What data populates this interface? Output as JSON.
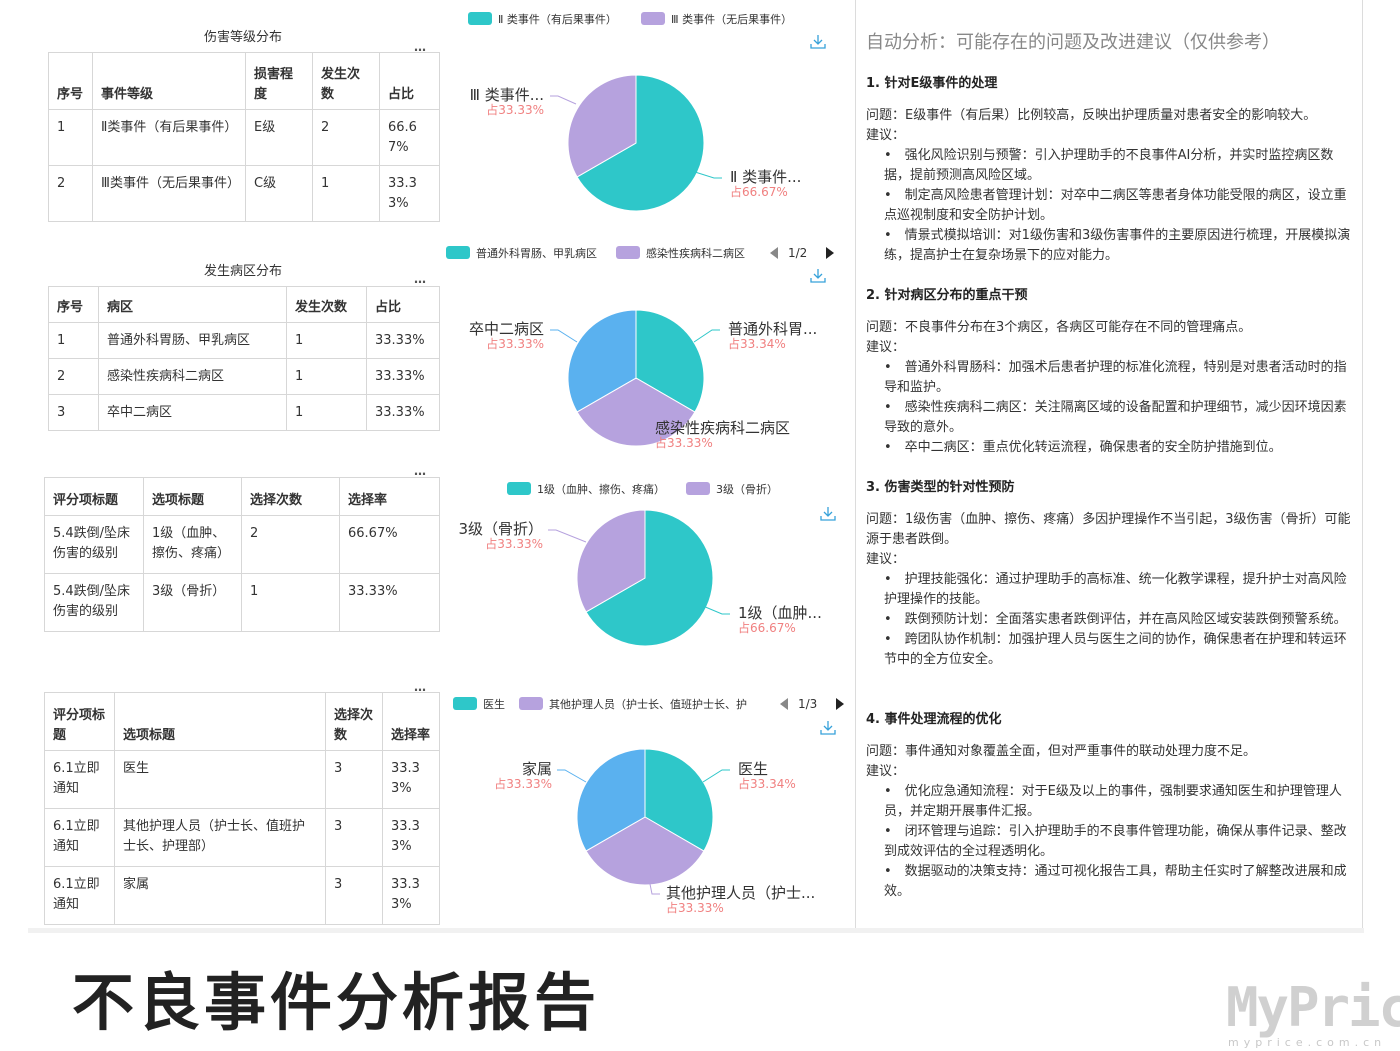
{
  "tables": [
    {
      "title": "伤害等级分布",
      "headers": [
        "序号",
        "事件等级",
        "损害程度",
        "发生次数",
        "占比"
      ],
      "rows": [
        [
          "1",
          "Ⅱ类事件（有后果事件）",
          "E级",
          "2",
          "66.67%"
        ],
        [
          "2",
          "Ⅲ类事件（无后果事件）",
          "C级",
          "1",
          "33.33%"
        ]
      ]
    },
    {
      "title": "发生病区分布",
      "headers": [
        "序号",
        "病区",
        "发生次数",
        "占比"
      ],
      "rows": [
        [
          "1",
          "普通外科胃肠、甲乳病区",
          "1",
          "33.33%"
        ],
        [
          "2",
          "感染性疾病科二病区",
          "1",
          "33.33%"
        ],
        [
          "3",
          "卒中二病区",
          "1",
          "33.33%"
        ]
      ]
    },
    {
      "title": "",
      "headers": [
        "评分项标题",
        "选项标题",
        "选择次数",
        "选择率"
      ],
      "rows": [
        [
          "5.4跌倒/坠床伤害的级别",
          "1级（血肿、擦伤、疼痛）",
          "2",
          "66.67%"
        ],
        [
          "5.4跌倒/坠床伤害的级别",
          "3级（骨折）",
          "1",
          "33.33%"
        ]
      ]
    },
    {
      "title": "",
      "headers": [
        "评分项标题",
        "选项标题",
        "选择次数",
        "选择率"
      ],
      "rows": [
        [
          "6.1立即通知",
          "医生",
          "3",
          "33.33%"
        ],
        [
          "6.1立即通知",
          "其他护理人员（护士长、值班护士长、护理部）",
          "3",
          "33.33%"
        ],
        [
          "6.1立即通知",
          "家属",
          "3",
          "33.33%"
        ]
      ]
    }
  ],
  "more_icon": "…",
  "download_icon": "download-icon",
  "chart_data": [
    {
      "type": "pie",
      "legend": [
        "Ⅱ 类事件（有后果事件）",
        "Ⅲ 类事件（无后果事件）"
      ],
      "slices": [
        {
          "name": "Ⅱ 类事件（有后果事件）",
          "value": 66.67,
          "label": "Ⅱ 类事件...",
          "pct": "占66.67%"
        },
        {
          "name": "Ⅲ 类事件（无后果事件）",
          "value": 33.33,
          "label": "Ⅲ 类事件...",
          "pct": "占33.33%"
        }
      ],
      "colors": [
        "#2ec7c9",
        "#b6a2de"
      ],
      "pager": ""
    },
    {
      "type": "pie",
      "legend": [
        "普通外科胃肠、甲乳病区",
        "感染性疾病科二病区"
      ],
      "slices": [
        {
          "name": "普通外科胃肠、甲乳病区",
          "value": 33.34,
          "label": "普通外科胃...",
          "pct": "占33.34%"
        },
        {
          "name": "感染性疾病科二病区",
          "value": 33.33,
          "label": "感染性疾病科二病区",
          "pct": "占33.33%"
        },
        {
          "name": "卒中二病区",
          "value": 33.33,
          "label": "卒中二病区",
          "pct": "占33.33%"
        }
      ],
      "colors": [
        "#2ec7c9",
        "#b6a2de",
        "#5ab1ef"
      ],
      "pager": "1/2"
    },
    {
      "type": "pie",
      "legend": [
        "1级（血肿、擦伤、疼痛）",
        "3级（骨折）"
      ],
      "slices": [
        {
          "name": "1级（血肿、擦伤、疼痛）",
          "value": 66.67,
          "label": "1级（血肿...",
          "pct": "占66.67%"
        },
        {
          "name": "3级（骨折）",
          "value": 33.33,
          "label": "3级（骨折）",
          "pct": "占33.33%"
        }
      ],
      "colors": [
        "#2ec7c9",
        "#b6a2de"
      ],
      "pager": ""
    },
    {
      "type": "pie",
      "legend": [
        "医生",
        "其他护理人员（护士长、值班护士长、护"
      ],
      "slices": [
        {
          "name": "医生",
          "value": 33.34,
          "label": "医生",
          "pct": "占33.34%"
        },
        {
          "name": "其他护理人员（护士长、值班护士长、护理部）",
          "value": 33.33,
          "label": "其他护理人员（护士...",
          "pct": "占33.33%"
        },
        {
          "name": "家属",
          "value": 33.33,
          "label": "家属",
          "pct": "占33.33%"
        }
      ],
      "colors": [
        "#2ec7c9",
        "#b6a2de",
        "#5ab1ef"
      ],
      "pager": "1/3"
    }
  ],
  "analysis": {
    "title": "自动分析：可能存在的问题及改进建议（仅供参考）",
    "sections": [
      {
        "heading": "1. 针对E级事件的处理",
        "problem": "问题：E级事件（有后果）比例较高，反映出护理质量对患者安全的影响较大。",
        "suggest_label": "建议：",
        "items": [
          "•　强化风险识别与预警：引入护理助手的不良事件AI分析，并实时监控病区数据，提前预测高风险区域。",
          "•　制定高风险患者管理计划：对卒中二病区等患者身体功能受限的病区，设立重点巡视制度和安全防护计划。",
          "•　情景式模拟培训：对1级伤害和3级伤害事件的主要原因进行梳理，开展模拟演练，提高护士在复杂场景下的应对能力。"
        ]
      },
      {
        "heading": "2. 针对病区分布的重点干预",
        "problem": "问题：不良事件分布在3个病区，各病区可能存在不同的管理痛点。",
        "suggest_label": "建议：",
        "items": [
          "•　普通外科胃肠科：加强术后患者护理的标准化流程，特别是对患者活动时的指导和监护。",
          "•　感染性疾病科二病区：关注隔离区域的设备配置和护理细节，减少因环境因素导致的意外。",
          "•　卒中二病区：重点优化转运流程，确保患者的安全防护措施到位。"
        ]
      },
      {
        "heading": "3. 伤害类型的针对性预防",
        "problem": "问题：1级伤害（血肿、擦伤、疼痛）多因护理操作不当引起，3级伤害（骨折）可能源于患者跌倒。",
        "suggest_label": "建议：",
        "items": [
          "•　护理技能强化：通过护理助手的高标准、统一化教学课程，提升护士对高风险护理操作的技能。",
          "•　跌倒预防计划：全面落实患者跌倒评估，并在高风险区域安装跌倒预警系统。",
          "•　跨团队协作机制：加强护理人员与医生之间的协作，确保患者在护理和转运环节中的全方位安全。"
        ]
      },
      {
        "heading": "4. 事件处理流程的优化",
        "problem": "问题：事件通知对象覆盖全面，但对严重事件的联动处理力度不足。",
        "suggest_label": "建议：",
        "items": [
          "•　优化应急通知流程：对于E级及以上的事件，强制要求通知医生和护理管理人员，并定期开展事件汇报。",
          "•　闭环管理与追踪：引入护理助手的不良事件管理功能，确保从事件记录、整改到成效评估的全过程透明化。",
          "•　数据驱动的决策支持：通过可视化报告工具，帮助主任实时了解整改进展和成效。"
        ]
      }
    ]
  },
  "page_title": "不良事件分析报告",
  "watermark": "MyPrice",
  "watermark_sub": "myprice.com.cn"
}
